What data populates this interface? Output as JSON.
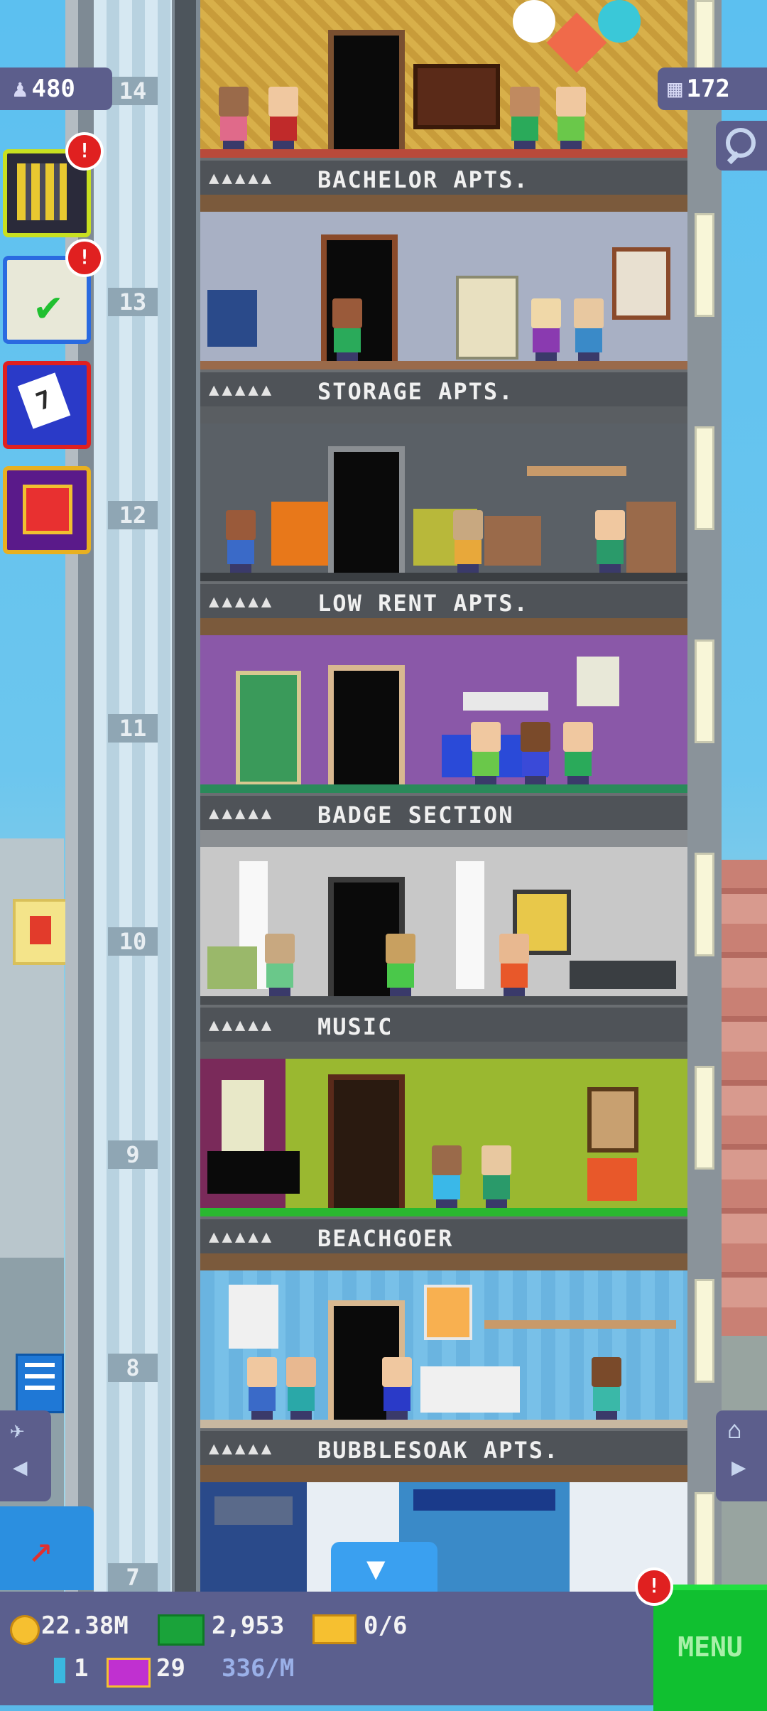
{
  "hud": {
    "population": "480",
    "tower_bux": "172"
  },
  "floors": [
    {
      "number": "14",
      "name": "BACHELOR APTS.",
      "stars": "▲▲▲▲▲",
      "theme": "#d8b04a"
    },
    {
      "number": "13",
      "name": "STORAGE APTS.",
      "stars": "▲▲▲▲▲",
      "theme": "#a8b0c4"
    },
    {
      "number": "12",
      "name": "LOW RENT APTS.",
      "stars": "▲▲▲▲▲",
      "theme": "#5a6066"
    },
    {
      "number": "11",
      "name": "BADGE SECTION",
      "stars": "▲▲▲▲▲",
      "theme": "#8a58a8"
    },
    {
      "number": "10",
      "name": "MUSIC",
      "stars": "▲▲▲▲▲",
      "theme": "#c8c8c8"
    },
    {
      "number": "9",
      "name": "BEACHGOER",
      "stars": "▲▲▲▲▲",
      "theme": "#9ab830"
    },
    {
      "number": "8",
      "name": "BUBBLESOAK APTS.",
      "stars": "▲▲▲▲▲",
      "theme": "#6ab4e0"
    },
    {
      "number": "7"
    }
  ],
  "side_buttons": [
    {
      "name": "tower-stats",
      "alert": "!"
    },
    {
      "name": "missions",
      "alert": "!"
    },
    {
      "name": "calendar",
      "day": "7"
    },
    {
      "name": "gift"
    }
  ],
  "menu_alert": "!",
  "currency": {
    "coins": "22.38M",
    "bux": "2,953",
    "tickets": "0/6",
    "elevators": "1",
    "vip": "29",
    "income_rate": "336/M"
  },
  "menu_label": "MENU",
  "colors": {
    "hud_bg": "#5b5f8e",
    "menu_green": "#10c030",
    "alert_red": "#e02020"
  },
  "icons": {
    "population": "person-icon",
    "bux": "building-icon",
    "search": "magnifier-icon"
  }
}
